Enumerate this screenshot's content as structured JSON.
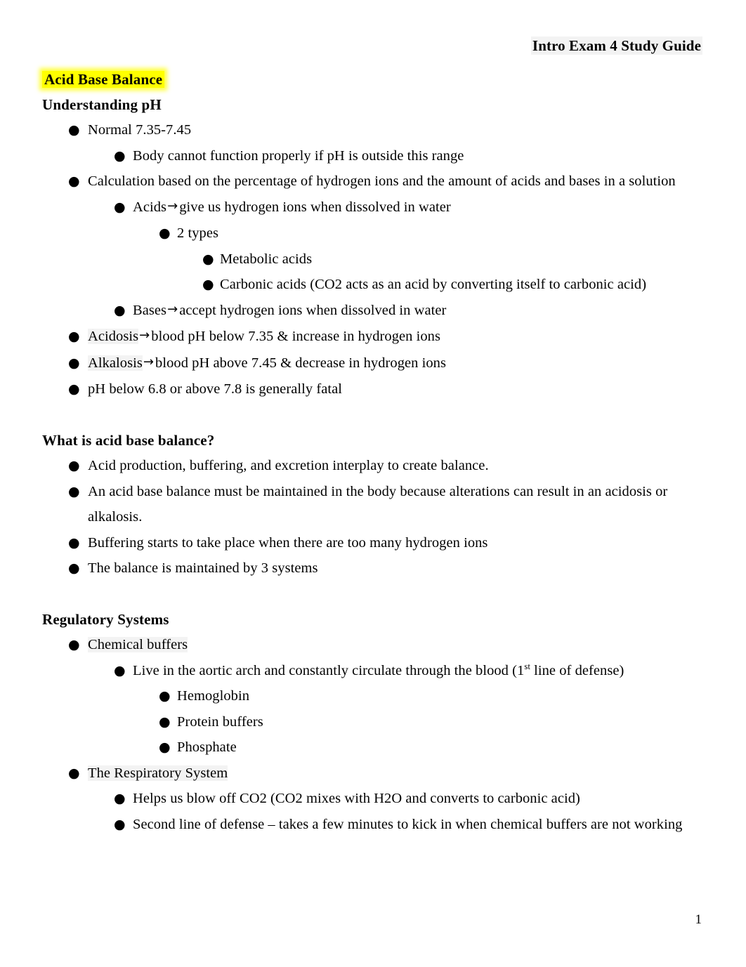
{
  "header": {
    "title": "Intro Exam 4 Study Guide"
  },
  "footer": {
    "page_number": "1"
  },
  "colors": {
    "highlight_yellow": "#ffff00",
    "text_shading_gray": "#f3f3f3",
    "text": "#000000",
    "page_background": "#ffffff"
  },
  "glyphs": {
    "bullet": "●",
    "arrow": "→",
    "ampersand": "&",
    "en_dash": "–"
  },
  "document": {
    "title": "Acid Base Balance",
    "sections": [
      {
        "heading": "Understanding pH",
        "items": [
          {
            "text": "Normal 7.35-7.45",
            "children": [
              {
                "text": "Body cannot function properly if pH is outside this range"
              }
            ]
          },
          {
            "text": "Calculation based on the percentage of hydrogen ions and the amount of acids and bases in a solution",
            "children": [
              {
                "pre": "Acids",
                "arrow": true,
                "post": "give us hydrogen ions when dissolved in water",
                "children": [
                  {
                    "text": "2 types",
                    "children": [
                      {
                        "text": "Metabolic acids"
                      },
                      {
                        "text": "Carbonic acids (CO2 acts as an acid by converting itself to carbonic acid)"
                      }
                    ]
                  }
                ]
              },
              {
                "pre": "Bases",
                "arrow": true,
                "post": "accept hydrogen ions when dissolved in water"
              }
            ]
          },
          {
            "pre": "Acidosis",
            "pre_shaded": true,
            "arrow": true,
            "post": "blood pH below 7.35 & increase in hydrogen ions"
          },
          {
            "pre": "Alkalosis",
            "pre_shaded": true,
            "arrow": true,
            "post": "blood pH above 7.45 & decrease in hydrogen ions"
          },
          {
            "text": "pH below 6.8 or above 7.8 is generally fatal"
          }
        ]
      },
      {
        "heading": "What is acid base balance?",
        "items": [
          {
            "text": "Acid production, buffering, and excretion interplay to create balance."
          },
          {
            "text": "An acid base balance must be maintained in the body because alterations can result in an acidosis or alkalosis."
          },
          {
            "text": "Buffering starts to take place when there are too many hydrogen ions"
          },
          {
            "text": "The balance is maintained by 3 systems"
          }
        ]
      },
      {
        "heading": "Regulatory Systems",
        "items": [
          {
            "text": "Chemical buffers",
            "shaded": true,
            "children": [
              {
                "text_pre_sup": "Live in the aortic arch and constantly circulate through the blood (1",
                "sup": "st",
                "text_post_sup": " line of defense)",
                "children": [
                  {
                    "text": "Hemoglobin"
                  },
                  {
                    "text": "Protein buffers"
                  },
                  {
                    "text": "Phosphate"
                  }
                ]
              }
            ]
          },
          {
            "text": "The Respiratory System",
            "shaded": true,
            "children": [
              {
                "text": "Helps us blow off CO2 (CO2 mixes with H2O and converts to carbonic acid)"
              },
              {
                "text": "Second line of defense – takes a few minutes to kick in when chemical buffers are not working"
              }
            ]
          }
        ]
      }
    ]
  }
}
